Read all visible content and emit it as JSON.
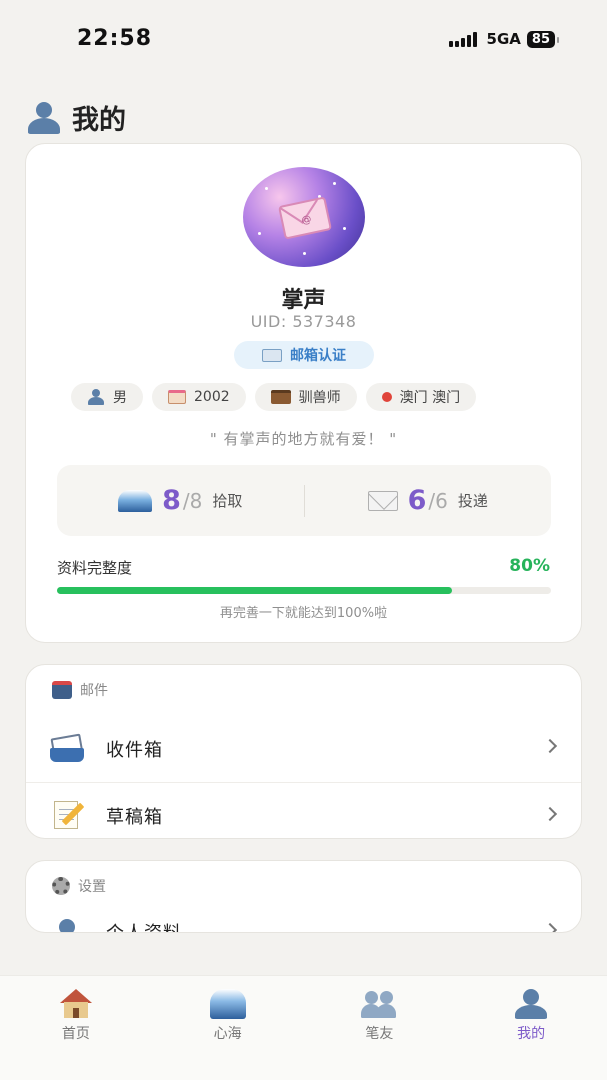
{
  "status_bar": {
    "time": "22:58",
    "network": "5GA",
    "battery": "85"
  },
  "page": {
    "title": "我的"
  },
  "profile": {
    "nickname": "掌声",
    "uid": "UID: 537348",
    "verify_label": "邮箱认证",
    "tags": [
      {
        "icon": "person-icon",
        "text": "男"
      },
      {
        "icon": "cake-icon",
        "text": "2002"
      },
      {
        "icon": "briefcase-icon",
        "text": "驯兽师"
      },
      {
        "icon": "pin-icon",
        "text": "澳门 澳门"
      }
    ],
    "motto": "\" 有掌声的地方就有爱！ \""
  },
  "stats": {
    "pick": {
      "count": "8",
      "total": "/8",
      "label": "拾取"
    },
    "deliver": {
      "count": "6",
      "total": "/6",
      "label": "投递"
    }
  },
  "progress": {
    "label": "资料完整度",
    "value_text": "80%",
    "value": 0.8,
    "hint": "再完善一下就能达到100%啦"
  },
  "mail_section": {
    "header": "邮件",
    "items": [
      {
        "label": "收件箱",
        "icon": "inbox-tray-icon"
      },
      {
        "label": "草稿箱",
        "icon": "memo-icon"
      }
    ]
  },
  "settings_section": {
    "header": "设置",
    "items": [
      {
        "label": "个人资料",
        "icon": "person-icon"
      }
    ]
  },
  "bottom_nav": [
    {
      "label": "首页",
      "icon": "house-icon",
      "active": false
    },
    {
      "label": "心海",
      "icon": "wave-icon",
      "active": false
    },
    {
      "label": "笔友",
      "icon": "people-icon",
      "active": false
    },
    {
      "label": "我的",
      "icon": "person-icon",
      "active": true
    }
  ],
  "colors": {
    "accent": "#7d5bc9",
    "progress": "#27c05d",
    "verify_text": "#3a7fc7",
    "background": "#f3f2ef"
  }
}
